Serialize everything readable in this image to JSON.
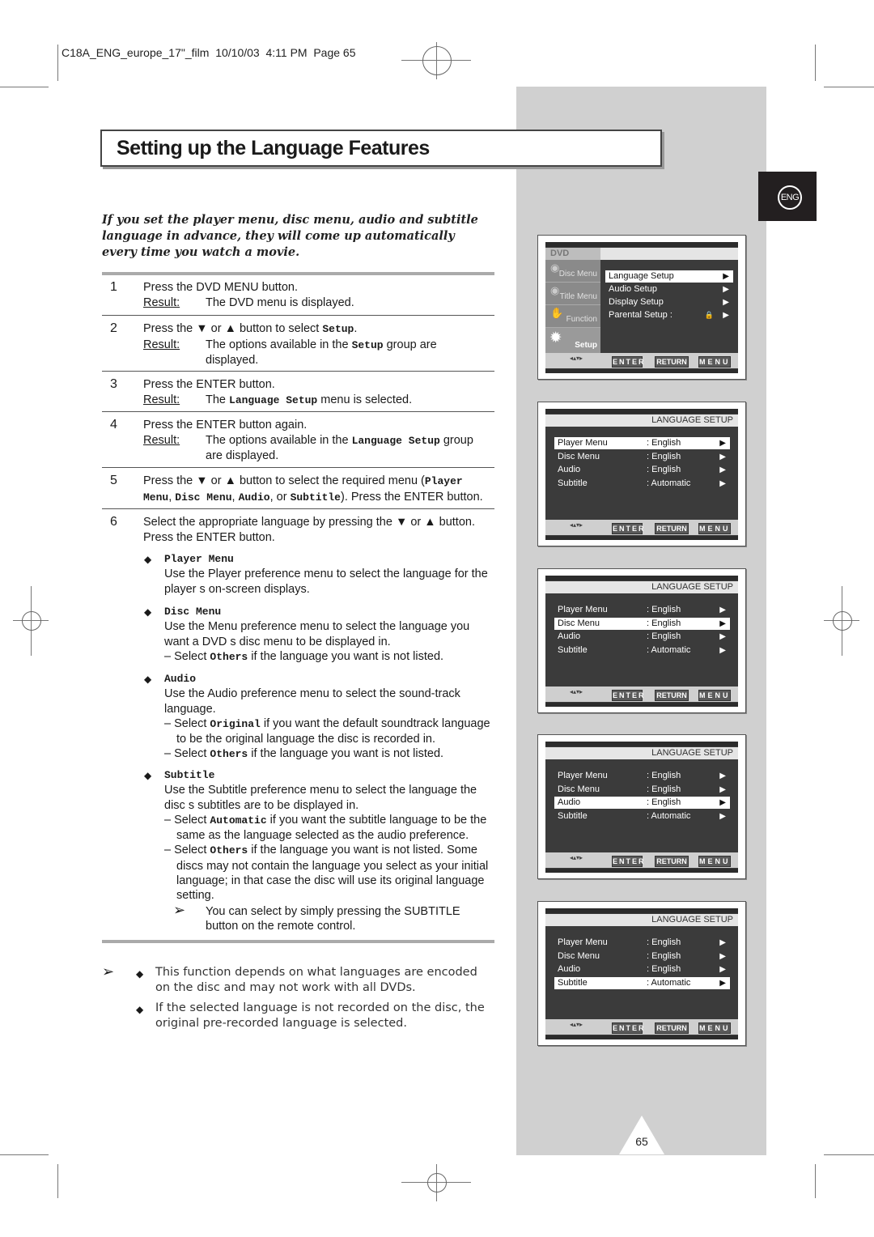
{
  "slug": "C18A_ENG_europe_17\"_film  10/10/03  4:11 PM  Page 65",
  "title": "Setting up the Language Features",
  "lang_tab": "ENG",
  "intro": "If you set the player menu, disc menu, audio and subtitle language in advance, they will come up automatically every time you watch a movie.",
  "result_label": "Result:",
  "steps": [
    {
      "num": "1",
      "instruction": "Press the DVD MENU button.",
      "result": "The DVD menu is displayed."
    },
    {
      "num": "2",
      "instruction_pre": "Press the ▼ or ▲ button to select ",
      "instruction_code": "Setup",
      "instruction_post": ".",
      "result_pre": "The options available in the ",
      "result_code": "Setup",
      "result_post": " group are displayed."
    },
    {
      "num": "3",
      "instruction": "Press the ENTER button.",
      "result_pre": "The ",
      "result_code": "Language Setup",
      "result_post": " menu is selected."
    },
    {
      "num": "4",
      "instruction": "Press the ENTER button again.",
      "result_pre": "The options available in the ",
      "result_code": "Language Setup",
      "result_post": " group are displayed."
    },
    {
      "num": "5",
      "instruction_pre": "Press the ▼ or ▲ button to select the required menu (",
      "codes": [
        "Player Menu",
        "Disc Menu",
        "Audio",
        "Subtitle"
      ],
      "sep1": ", ",
      "sep2": ", ",
      "sep3": ", or ",
      "instruction_post": "). Press the ENTER button."
    },
    {
      "num": "6",
      "instruction": "Select the appropriate language by pressing the ▼ or ▲ button. Press the ENTER button."
    }
  ],
  "options": [
    {
      "name": "Player Menu",
      "desc": "Use the Player preference menu to select the language for the player s on-screen displays.",
      "notes": []
    },
    {
      "name": "Disc Menu",
      "desc": "Use the Menu preference menu to select the language you want a DVD s disc menu to be displayed in.",
      "notes": [
        {
          "pre": "– Select ",
          "code": "Others",
          "post": " if the language you want is not listed."
        }
      ]
    },
    {
      "name": "Audio",
      "desc": "Use the Audio preference menu to select the sound-track language.",
      "notes": [
        {
          "pre": "– Select ",
          "code": "Original",
          "post": " if you want the default soundtrack language to be the original language the disc is recorded in."
        },
        {
          "pre": "– Select ",
          "code": "Others",
          "post": " if the language you want is not listed."
        }
      ]
    },
    {
      "name": "Subtitle",
      "desc": "Use the Subtitle preference menu to select the language the disc s subtitles are to be displayed in.",
      "notes": [
        {
          "pre": "– Select ",
          "code": "Automatic",
          "post": " if you want the subtitle language to be the same as the language selected as the audio preference."
        },
        {
          "pre": "– Select ",
          "code": "Others",
          "post": " if the language you want is not listed. Some discs may not contain the language you select as your initial language; in that case the disc will use its original language setting."
        }
      ]
    }
  ],
  "subtitle_tip": "You can select by simply pressing the SUBTITLE button on the remote control.",
  "footnotes": [
    "This function depends on what languages are encoded on the disc and may not work with all DVDs.",
    "If the selected language is not recorded on the disc, the original pre-recorded language is selected."
  ],
  "dvd_menu": {
    "header": "DVD",
    "side_tabs": [
      "Disc Menu",
      "Title Menu",
      "Function",
      "Setup"
    ],
    "items": [
      "Language Setup",
      "Audio Setup",
      "Display Setup",
      "Parental Setup :"
    ],
    "selected_index": 0
  },
  "language_setup": {
    "header": "LANGUAGE SETUP",
    "rows": [
      {
        "label": "Player Menu",
        "value": ": English"
      },
      {
        "label": "Disc Menu",
        "value": ": English"
      },
      {
        "label": "Audio",
        "value": ": English"
      },
      {
        "label": "Subtitle",
        "value": ": Automatic"
      }
    ],
    "screens_selected": [
      0,
      1,
      2,
      3
    ]
  },
  "osd_buttons": {
    "enter": "ENTER",
    "return": "RETURN",
    "menu": "MENU"
  },
  "page_number": "65"
}
